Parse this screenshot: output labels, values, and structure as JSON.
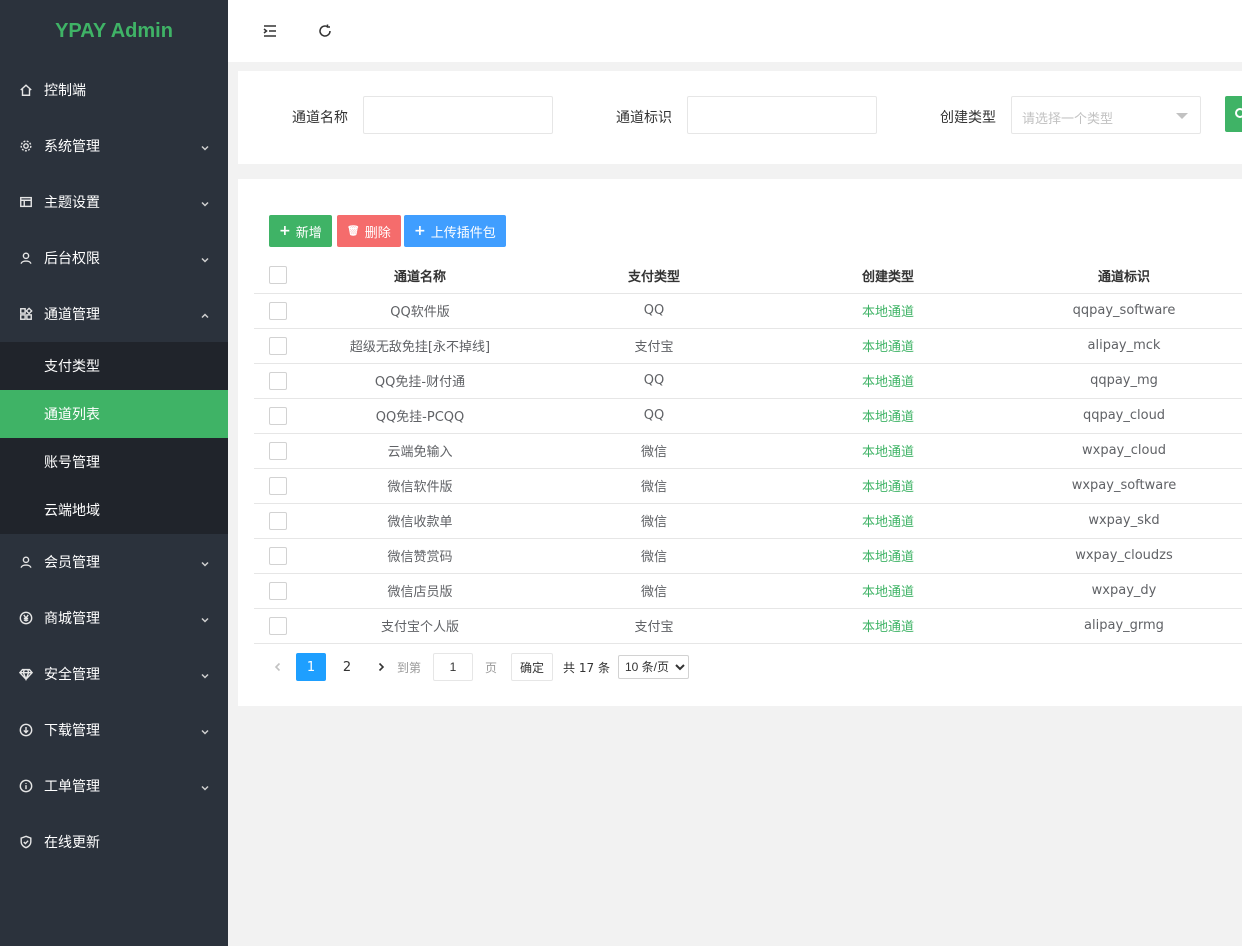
{
  "app": {
    "logo": "YPAY Admin"
  },
  "sidebar": {
    "items": [
      {
        "label": "控制端",
        "icon": "home-icon"
      },
      {
        "label": "系统管理",
        "icon": "gear-icon"
      },
      {
        "label": "主题设置",
        "icon": "layout-icon"
      },
      {
        "label": "后台权限",
        "icon": "user-icon"
      },
      {
        "label": "通道管理",
        "icon": "grid-apps-icon"
      },
      {
        "label": "会员管理",
        "icon": "user-icon"
      },
      {
        "label": "商城管理",
        "icon": "yen-icon"
      },
      {
        "label": "安全管理",
        "icon": "diamond-icon"
      },
      {
        "label": "下载管理",
        "icon": "download-icon"
      },
      {
        "label": "工单管理",
        "icon": "info-icon"
      },
      {
        "label": "在线更新",
        "icon": "shield-check-icon"
      }
    ],
    "submenu": [
      {
        "label": "支付类型"
      },
      {
        "label": "通道列表"
      },
      {
        "label": "账号管理"
      },
      {
        "label": "云端地域"
      }
    ],
    "accent": "#3fb366"
  },
  "search": {
    "name_label": "通道名称",
    "name_value": "",
    "flag_label": "通道标识",
    "flag_value": "",
    "type_label": "创建类型",
    "type_placeholder": "请选择一个类型"
  },
  "toolbar": {
    "add_label": "新增",
    "delete_label": "删除",
    "upload_label": "上传插件包"
  },
  "table": {
    "headers": [
      "通道名称",
      "支付类型",
      "创建类型",
      "通道标识"
    ],
    "rows": [
      [
        "QQ软件版",
        "QQ",
        "本地通道",
        "qqpay_software"
      ],
      [
        "超级无敌免挂[永不掉线]",
        "支付宝",
        "本地通道",
        "alipay_mck"
      ],
      [
        "QQ免挂-财付通",
        "QQ",
        "本地通道",
        "qqpay_mg"
      ],
      [
        "QQ免挂-PCQQ",
        "QQ",
        "本地通道",
        "qqpay_cloud"
      ],
      [
        "云端免输入",
        "微信",
        "本地通道",
        "wxpay_cloud"
      ],
      [
        "微信软件版",
        "微信",
        "本地通道",
        "wxpay_software"
      ],
      [
        "微信收款单",
        "微信",
        "本地通道",
        "wxpay_skd"
      ],
      [
        "微信赞赏码",
        "微信",
        "本地通道",
        "wxpay_cloudzs"
      ],
      [
        "微信店员版",
        "微信",
        "本地通道",
        "wxpay_dy"
      ],
      [
        "支付宝个人版",
        "支付宝",
        "本地通道",
        "alipay_grmg"
      ]
    ]
  },
  "pagination": {
    "pages": [
      "1",
      "2"
    ],
    "current": "1",
    "goto_label": "到第",
    "goto_value": "1",
    "page_unit": "页",
    "confirm_label": "确定",
    "total_text": "共 17 条",
    "page_size": "10 条/页"
  }
}
